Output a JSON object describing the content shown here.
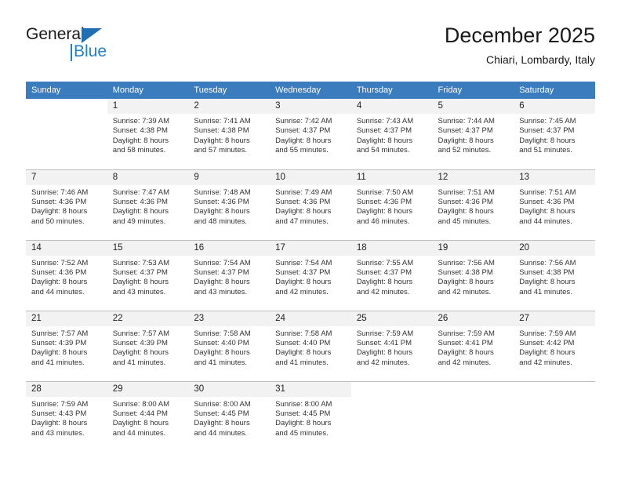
{
  "brand": {
    "name_part1": "General",
    "name_part2": "Blue",
    "logo_icon": "triangle-flag-icon",
    "accent_color": "#1f7fd0"
  },
  "header": {
    "title": "December 2025",
    "subtitle": "Chiari, Lombardy, Italy"
  },
  "calendar": {
    "header_bg": "#3a7cbe",
    "daynum_bg": "#f2f2f2",
    "weekday_labels": [
      "Sunday",
      "Monday",
      "Tuesday",
      "Wednesday",
      "Thursday",
      "Friday",
      "Saturday"
    ],
    "weeks": [
      [
        {
          "day": "",
          "sunrise": "",
          "sunset": "",
          "daylight_line1": "",
          "daylight_line2": ""
        },
        {
          "day": "1",
          "sunrise": "Sunrise: 7:39 AM",
          "sunset": "Sunset: 4:38 PM",
          "daylight_line1": "Daylight: 8 hours",
          "daylight_line2": "and 58 minutes."
        },
        {
          "day": "2",
          "sunrise": "Sunrise: 7:41 AM",
          "sunset": "Sunset: 4:38 PM",
          "daylight_line1": "Daylight: 8 hours",
          "daylight_line2": "and 57 minutes."
        },
        {
          "day": "3",
          "sunrise": "Sunrise: 7:42 AM",
          "sunset": "Sunset: 4:37 PM",
          "daylight_line1": "Daylight: 8 hours",
          "daylight_line2": "and 55 minutes."
        },
        {
          "day": "4",
          "sunrise": "Sunrise: 7:43 AM",
          "sunset": "Sunset: 4:37 PM",
          "daylight_line1": "Daylight: 8 hours",
          "daylight_line2": "and 54 minutes."
        },
        {
          "day": "5",
          "sunrise": "Sunrise: 7:44 AM",
          "sunset": "Sunset: 4:37 PM",
          "daylight_line1": "Daylight: 8 hours",
          "daylight_line2": "and 52 minutes."
        },
        {
          "day": "6",
          "sunrise": "Sunrise: 7:45 AM",
          "sunset": "Sunset: 4:37 PM",
          "daylight_line1": "Daylight: 8 hours",
          "daylight_line2": "and 51 minutes."
        }
      ],
      [
        {
          "day": "7",
          "sunrise": "Sunrise: 7:46 AM",
          "sunset": "Sunset: 4:36 PM",
          "daylight_line1": "Daylight: 8 hours",
          "daylight_line2": "and 50 minutes."
        },
        {
          "day": "8",
          "sunrise": "Sunrise: 7:47 AM",
          "sunset": "Sunset: 4:36 PM",
          "daylight_line1": "Daylight: 8 hours",
          "daylight_line2": "and 49 minutes."
        },
        {
          "day": "9",
          "sunrise": "Sunrise: 7:48 AM",
          "sunset": "Sunset: 4:36 PM",
          "daylight_line1": "Daylight: 8 hours",
          "daylight_line2": "and 48 minutes."
        },
        {
          "day": "10",
          "sunrise": "Sunrise: 7:49 AM",
          "sunset": "Sunset: 4:36 PM",
          "daylight_line1": "Daylight: 8 hours",
          "daylight_line2": "and 47 minutes."
        },
        {
          "day": "11",
          "sunrise": "Sunrise: 7:50 AM",
          "sunset": "Sunset: 4:36 PM",
          "daylight_line1": "Daylight: 8 hours",
          "daylight_line2": "and 46 minutes."
        },
        {
          "day": "12",
          "sunrise": "Sunrise: 7:51 AM",
          "sunset": "Sunset: 4:36 PM",
          "daylight_line1": "Daylight: 8 hours",
          "daylight_line2": "and 45 minutes."
        },
        {
          "day": "13",
          "sunrise": "Sunrise: 7:51 AM",
          "sunset": "Sunset: 4:36 PM",
          "daylight_line1": "Daylight: 8 hours",
          "daylight_line2": "and 44 minutes."
        }
      ],
      [
        {
          "day": "14",
          "sunrise": "Sunrise: 7:52 AM",
          "sunset": "Sunset: 4:36 PM",
          "daylight_line1": "Daylight: 8 hours",
          "daylight_line2": "and 44 minutes."
        },
        {
          "day": "15",
          "sunrise": "Sunrise: 7:53 AM",
          "sunset": "Sunset: 4:37 PM",
          "daylight_line1": "Daylight: 8 hours",
          "daylight_line2": "and 43 minutes."
        },
        {
          "day": "16",
          "sunrise": "Sunrise: 7:54 AM",
          "sunset": "Sunset: 4:37 PM",
          "daylight_line1": "Daylight: 8 hours",
          "daylight_line2": "and 43 minutes."
        },
        {
          "day": "17",
          "sunrise": "Sunrise: 7:54 AM",
          "sunset": "Sunset: 4:37 PM",
          "daylight_line1": "Daylight: 8 hours",
          "daylight_line2": "and 42 minutes."
        },
        {
          "day": "18",
          "sunrise": "Sunrise: 7:55 AM",
          "sunset": "Sunset: 4:37 PM",
          "daylight_line1": "Daylight: 8 hours",
          "daylight_line2": "and 42 minutes."
        },
        {
          "day": "19",
          "sunrise": "Sunrise: 7:56 AM",
          "sunset": "Sunset: 4:38 PM",
          "daylight_line1": "Daylight: 8 hours",
          "daylight_line2": "and 42 minutes."
        },
        {
          "day": "20",
          "sunrise": "Sunrise: 7:56 AM",
          "sunset": "Sunset: 4:38 PM",
          "daylight_line1": "Daylight: 8 hours",
          "daylight_line2": "and 41 minutes."
        }
      ],
      [
        {
          "day": "21",
          "sunrise": "Sunrise: 7:57 AM",
          "sunset": "Sunset: 4:39 PM",
          "daylight_line1": "Daylight: 8 hours",
          "daylight_line2": "and 41 minutes."
        },
        {
          "day": "22",
          "sunrise": "Sunrise: 7:57 AM",
          "sunset": "Sunset: 4:39 PM",
          "daylight_line1": "Daylight: 8 hours",
          "daylight_line2": "and 41 minutes."
        },
        {
          "day": "23",
          "sunrise": "Sunrise: 7:58 AM",
          "sunset": "Sunset: 4:40 PM",
          "daylight_line1": "Daylight: 8 hours",
          "daylight_line2": "and 41 minutes."
        },
        {
          "day": "24",
          "sunrise": "Sunrise: 7:58 AM",
          "sunset": "Sunset: 4:40 PM",
          "daylight_line1": "Daylight: 8 hours",
          "daylight_line2": "and 41 minutes."
        },
        {
          "day": "25",
          "sunrise": "Sunrise: 7:59 AM",
          "sunset": "Sunset: 4:41 PM",
          "daylight_line1": "Daylight: 8 hours",
          "daylight_line2": "and 42 minutes."
        },
        {
          "day": "26",
          "sunrise": "Sunrise: 7:59 AM",
          "sunset": "Sunset: 4:41 PM",
          "daylight_line1": "Daylight: 8 hours",
          "daylight_line2": "and 42 minutes."
        },
        {
          "day": "27",
          "sunrise": "Sunrise: 7:59 AM",
          "sunset": "Sunset: 4:42 PM",
          "daylight_line1": "Daylight: 8 hours",
          "daylight_line2": "and 42 minutes."
        }
      ],
      [
        {
          "day": "28",
          "sunrise": "Sunrise: 7:59 AM",
          "sunset": "Sunset: 4:43 PM",
          "daylight_line1": "Daylight: 8 hours",
          "daylight_line2": "and 43 minutes."
        },
        {
          "day": "29",
          "sunrise": "Sunrise: 8:00 AM",
          "sunset": "Sunset: 4:44 PM",
          "daylight_line1": "Daylight: 8 hours",
          "daylight_line2": "and 44 minutes."
        },
        {
          "day": "30",
          "sunrise": "Sunrise: 8:00 AM",
          "sunset": "Sunset: 4:45 PM",
          "daylight_line1": "Daylight: 8 hours",
          "daylight_line2": "and 44 minutes."
        },
        {
          "day": "31",
          "sunrise": "Sunrise: 8:00 AM",
          "sunset": "Sunset: 4:45 PM",
          "daylight_line1": "Daylight: 8 hours",
          "daylight_line2": "and 45 minutes."
        },
        {
          "day": "",
          "sunrise": "",
          "sunset": "",
          "daylight_line1": "",
          "daylight_line2": ""
        },
        {
          "day": "",
          "sunrise": "",
          "sunset": "",
          "daylight_line1": "",
          "daylight_line2": ""
        },
        {
          "day": "",
          "sunrise": "",
          "sunset": "",
          "daylight_line1": "",
          "daylight_line2": ""
        }
      ]
    ]
  }
}
